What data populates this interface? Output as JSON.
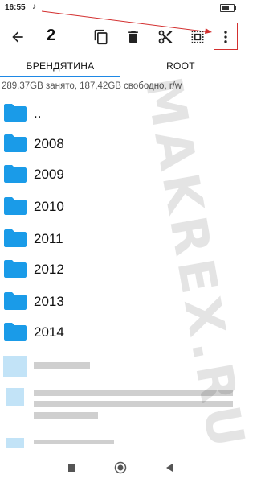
{
  "status": {
    "time": "16:55",
    "notification_glyph": "♪"
  },
  "toolbar": {
    "back_icon": "arrow-back-icon",
    "selected_count": "2",
    "actions": [
      "copy-icon",
      "delete-icon",
      "cut-icon",
      "select-all-icon",
      "more-vert-icon"
    ]
  },
  "tabs": [
    {
      "label": "БРЕНДЯТИНА",
      "active": true
    },
    {
      "label": "ROOT",
      "active": false
    }
  ],
  "storage_info": "289,37GB занято, 187,42GB свободно, r/w",
  "folders": [
    "..",
    "2008",
    "2009",
    "2010",
    "2011",
    "2012",
    "2013",
    "2014"
  ],
  "watermark": "MAKREX.RU",
  "colors": {
    "accent": "#1e88e5",
    "folder": "#1a9be8",
    "highlight": "#d32f2f"
  }
}
